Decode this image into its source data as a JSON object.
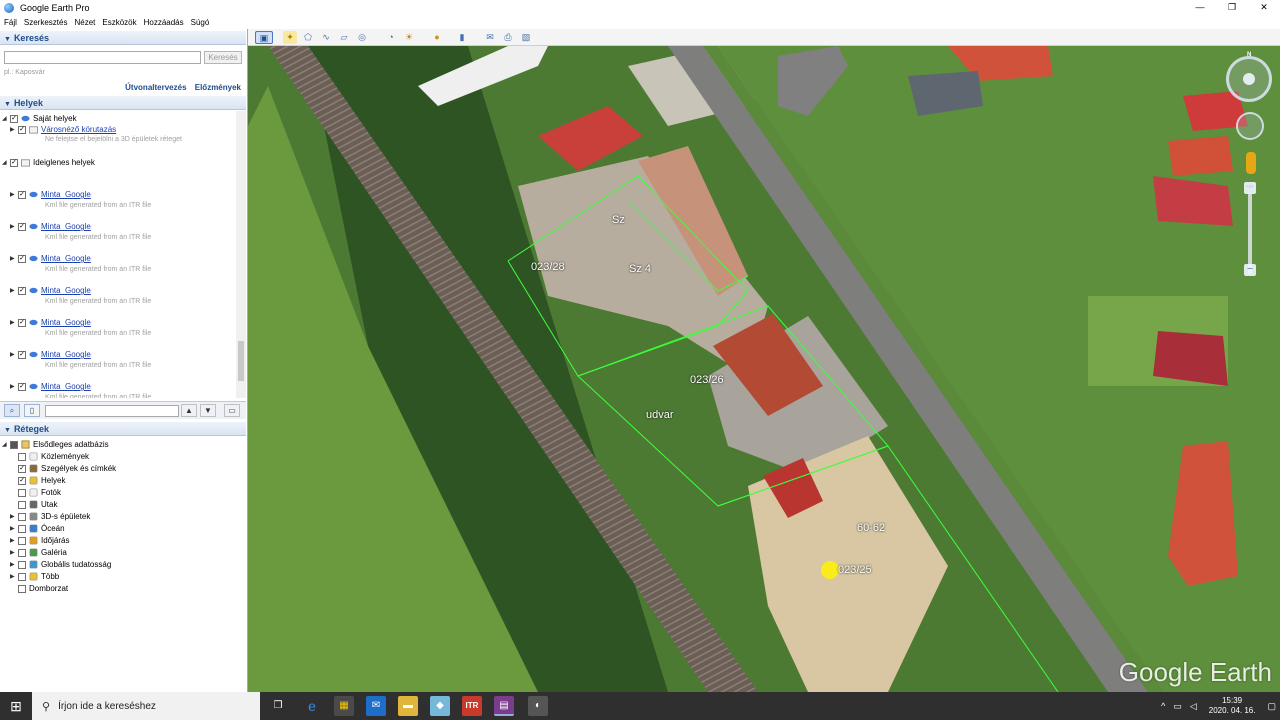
{
  "window": {
    "title": "Google Earth Pro"
  },
  "menu": [
    "Fájl",
    "Szerkesztés",
    "Nézet",
    "Eszközök",
    "Hozzáadás",
    "Súgó"
  ],
  "search": {
    "header": "Keresés",
    "button": "Keresés",
    "hint": "pl.: Kaposvár",
    "links": [
      "Útvonaltervezés",
      "Előzmények"
    ]
  },
  "places": {
    "header": "Helyek",
    "my_places": "Saját helyek",
    "city_tour": "Városnéző körutazás",
    "city_tour_note": "Ne felejtse el bejelölni a 3D épületek réteget",
    "temporary": "Ideiglenes helyek",
    "items": [
      {
        "name": "Minta_Google",
        "desc": "Kml file generated from an ITR file"
      },
      {
        "name": "Minta_Google",
        "desc": "Kml file generated from an ITR file"
      },
      {
        "name": "Minta_Google",
        "desc": "Kml file generated from an ITR file"
      },
      {
        "name": "Minta_Google",
        "desc": "Kml file generated from an ITR file"
      },
      {
        "name": "Minta_Google",
        "desc": "Kml file generated from an ITR file"
      },
      {
        "name": "Minta_Google",
        "desc": "Kml file generated from an ITR file"
      },
      {
        "name": "Minta_Google",
        "desc": "Kml file generated from an ITR file"
      },
      {
        "name": "Minta_Google",
        "desc": ""
      }
    ]
  },
  "layers": {
    "header": "Rétegek",
    "root": "Elsődleges adatbázis",
    "items": [
      {
        "label": "Közlemények",
        "checked": false
      },
      {
        "label": "Szegélyek és címkék",
        "checked": true
      },
      {
        "label": "Helyek",
        "checked": true
      },
      {
        "label": "Fotók",
        "checked": false
      },
      {
        "label": "Utak",
        "checked": false
      },
      {
        "label": "3D-s épületek",
        "checked": false
      },
      {
        "label": "Óceán",
        "checked": false
      },
      {
        "label": "Időjárás",
        "checked": false
      },
      {
        "label": "Galéria",
        "checked": false
      },
      {
        "label": "Globális tudatosság",
        "checked": false
      },
      {
        "label": "Több",
        "checked": false
      },
      {
        "label": "Domborzat",
        "checked": false
      }
    ]
  },
  "map": {
    "labels": [
      "Sz",
      "023/28",
      "Sz 4",
      "023/26",
      "udvar",
      "60-62",
      "023/25"
    ],
    "logo": "Google Earth",
    "compass_n": "N"
  },
  "taskbar": {
    "search_placeholder": "Írjon ide a kereséshez",
    "time": "15:39",
    "date": "2020. 04. 16.",
    "itr_label": "ITR"
  },
  "colors": {
    "panel_header": "#1f4c8a",
    "link": "#1a3fb0",
    "parcel_line": "#3cff3c"
  }
}
